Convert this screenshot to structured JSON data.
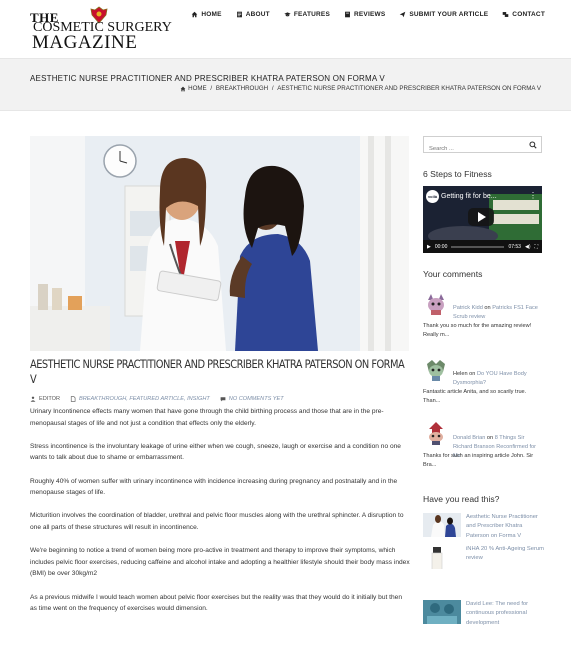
{
  "site": {
    "logo_line1": "THE",
    "logo_line2": "COSMETIC SURGERY",
    "logo_line3": "MAGAZINE"
  },
  "nav": [
    {
      "label": "HOME",
      "icon": "home-icon"
    },
    {
      "label": "ABOUT",
      "icon": "document-icon"
    },
    {
      "label": "FEATURES",
      "icon": "graduation-cap-icon"
    },
    {
      "label": "REVIEWS",
      "icon": "book-icon"
    },
    {
      "label": "SUBMIT YOUR ARTICLE",
      "icon": "send-icon"
    },
    {
      "label": "CONTACT",
      "icon": "contacts-icon"
    }
  ],
  "page": {
    "title": "AESTHETIC NURSE PRACTITIONER AND PRESCRIBER KHATRA PATERSON ON FORMA V",
    "breadcrumb": {
      "home": "HOME",
      "sep1": " / ",
      "category": "BREAKTHROUGH",
      "sep2": " / ",
      "current": "AESTHETIC NURSE PRACTITIONER AND PRESCRIBER KHATRA PATERSON ON FORMA V"
    }
  },
  "post": {
    "title": "AESTHETIC NURSE PRACTITIONER AND PRESCRIBER KHATRA PATERSON ON FORMA V",
    "author": "EDITOR",
    "categories": "BREAKTHROUGH, FEATURED ARTICLE, INSIGHT",
    "comments": "NO COMMENTS YET",
    "paragraphs": [
      "Urinary Incontinence effects many women that have gone through the child birthing process and those that are in the pre-menopausal stages of life and not just a condition that effects only the elderly.",
      "Stress incontinence is the involuntary leakage of urine either when we cough, sneeze, laugh or exercise and a condition no one wants to talk about due to shame or embarrassment.",
      "Roughly 40% of women suffer with urinary incontinence with incidence increasing during pregnancy and postnatally and in the menopause stages of life.",
      "Micturition involves the coordination of bladder, urethral and pelvic floor muscles along with the urethral sphincter. A disruption to one all parts of these structures will result in incontinence.",
      "We're beginning to notice a trend of women being more pro-active in treatment and therapy to improve their symptoms, which includes pelvic floor exercises, reducing caffeine and alcohol intake and adopting a healthier lifestyle should their body mass index (BMI) be over 30kg/m2",
      "As a previous midwife I would teach women about pelvic floor exercises but the reality was that they would do it initially but then as time went on the frequency of exercises would dimension."
    ]
  },
  "sidebar": {
    "search_placeholder": "Search ...",
    "fitness_heading": "6 Steps to Fitness",
    "video": {
      "channel": "voilà",
      "title": "Getting fit for be...",
      "time_current": "00:00",
      "time_total": "07:53"
    },
    "comments_heading": "Your comments",
    "comments": [
      {
        "author": "Patrick Kidd",
        "on": " on ",
        "link": "Patricks FS1 Face Scrub review",
        "text": "Thank you so much for the amazing review! Really m..."
      },
      {
        "author": "Helen",
        "on": " on ",
        "link": "Do YOU Have Body Dysmorphia?",
        "text": "Fantastic article Anita, and so scarily true. Than..."
      },
      {
        "author": "Donald Brian",
        "on": " on ",
        "link": "8 Things Sir Richard Branson Reconfirmed for Me",
        "text": "Thanks for such an inspiring article John. Sir Bra..."
      }
    ],
    "read_heading": "Have you read this?",
    "read": [
      {
        "title": "Aesthetic Nurse Practitioner and Prescriber Khatra Paterson on Forma V"
      },
      {
        "title": "iNHA 20 % Anti-Ageing Serum review"
      },
      {
        "title": "David Lee: The need for continuous professional development"
      }
    ]
  },
  "colors": {
    "link": "#7d8fa8",
    "titlebar_bg": "#f2f2f2"
  }
}
